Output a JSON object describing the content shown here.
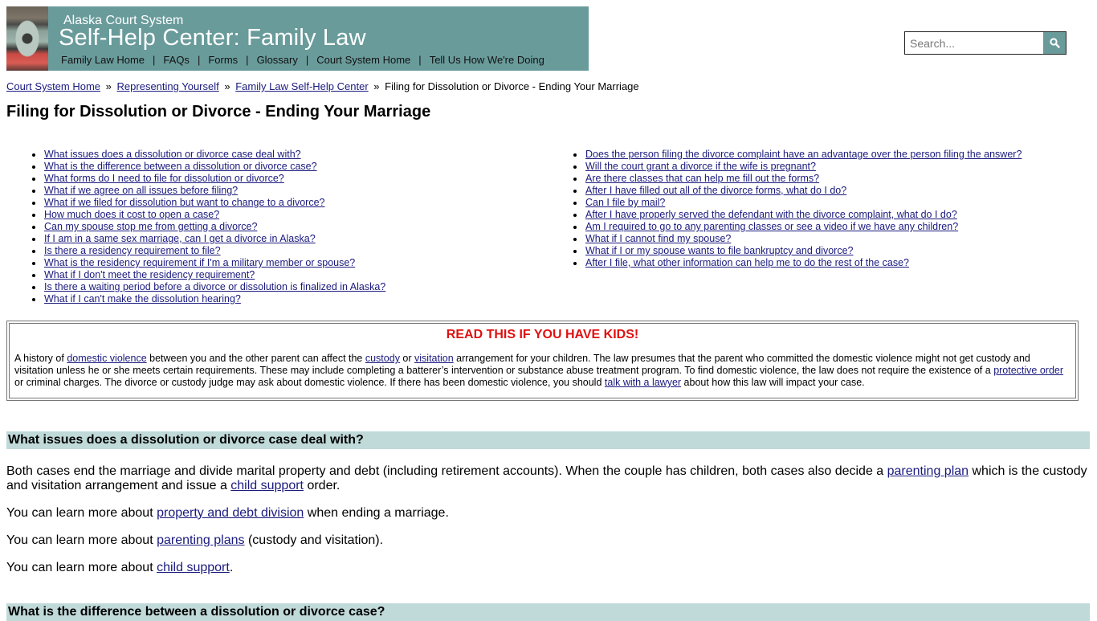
{
  "header": {
    "subtitle": "Alaska Court System",
    "title": "Self-Help Center: Family Law",
    "nav": [
      "Family Law Home",
      "FAQs",
      "Forms",
      "Glossary",
      "Court System Home",
      "Tell Us How We're Doing"
    ],
    "nav_separator": "|",
    "brand_color": "#6a9b9b"
  },
  "search": {
    "placeholder": "Search...",
    "value": "",
    "button_icon": "search-icon"
  },
  "breadcrumb": {
    "links": [
      "Court System Home",
      "Representing Yourself",
      "Family Law Self-Help Center"
    ],
    "separator": "»",
    "current": "Filing for Dissolution or Divorce - Ending Your Marriage"
  },
  "page_title": "Filing for Dissolution or Divorce - Ending Your Marriage",
  "questions_left": [
    "What issues does a dissolution or divorce case deal with?",
    "What is the difference between a dissolution or divorce case?",
    "What forms do I need to file for dissolution or divorce?",
    "What if we agree on all issues before filing?",
    "What if we filed for dissolution but want to change to a divorce?",
    "How much does it cost to open a case?",
    "Can my spouse stop me from getting a divorce?",
    "If I am in a same sex marriage, can I get a divorce in Alaska?",
    "Is there a residency requirement to file?",
    "What is the residency requirement if I'm a military member or spouse?",
    "What if I don't meet the residency requirement?",
    "Is there a waiting period before a divorce or dissolution is finalized in Alaska?",
    "What if I can't make the dissolution hearing?"
  ],
  "questions_right": [
    "Does the person filing the divorce complaint have an advantage over the person filing the answer?",
    "Will the court grant a divorce if the wife is pregnant?",
    "Are there classes that can help me fill out the forms?",
    "After I have filled out all of the divorce forms, what do I do?",
    "Can I file by mail?",
    "After I have properly served the defendant with the divorce complaint, what do I do?",
    "Am I required to go to any parenting classes or see a video if we have any children?",
    "What if I cannot find my spouse?",
    "What if I or my spouse wants to file bankruptcy and divorce?",
    "After I file, what other information can help me to do the rest of the case?"
  ],
  "kids_box": {
    "title": "READ THIS IF YOU HAVE KIDS!",
    "title_color": "#e01010",
    "t1": "A history of ",
    "l1": "domestic violence",
    "t2": " between you and the other parent can affect the ",
    "l2": "custody",
    "t3": " or ",
    "l3": "visitation",
    "t4": " arrangement for your children. The law presumes that the parent who committed the domestic violence might not get custody and visitation unless he or she meets certain requirements. These may include completing a batterer’s intervention or substance abuse treatment program. To find domestic violence, the law does not require the existence of a ",
    "l4": "protective order",
    "t5": " or criminal charges. The divorce or custody judge may ask about domestic violence. If there has been domestic violence, you should ",
    "l5": "talk with a lawyer",
    "t6": " about how this law will impact your case."
  },
  "section1": {
    "heading": "What issues does a dissolution or divorce case deal with?",
    "p1_t1": "Both cases end the marriage and divide marital property and debt (including retirement accounts). When the couple has children, both cases also decide a ",
    "p1_l1": "parenting plan",
    "p1_t2": " which is the custody and visitation arrangement and issue a ",
    "p1_l2": "child support",
    "p1_t3": " order.",
    "p2_t1": "You can learn more about ",
    "p2_l1": "property and debt division",
    "p2_t2": " when ending a marriage.",
    "p3_t1": "You can learn more about ",
    "p3_l1": "parenting plans",
    "p3_t2": " (custody and visitation).",
    "p4_t1": "You can learn more about ",
    "p4_l1": "child support",
    "p4_t2": "."
  },
  "section2": {
    "heading": "What is the difference between a dissolution or divorce case?"
  },
  "colors": {
    "section_heading_bg": "#c0d9d9",
    "link": "#1a1a7e"
  }
}
